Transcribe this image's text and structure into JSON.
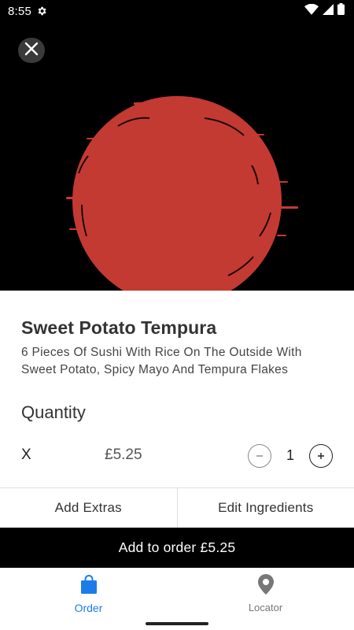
{
  "status_bar": {
    "time": "8:55"
  },
  "product": {
    "title": "Sweet Potato Tempura",
    "description": "6 Pieces Of Sushi With Rice On The Outside With Sweet Potato, Spicy Mayo And Tempura Flakes"
  },
  "quantity": {
    "heading": "Quantity",
    "prefix": "X",
    "unit_price": "£5.25",
    "minus_symbol": "−",
    "value": "1",
    "plus_symbol": "+"
  },
  "options": {
    "extras_label": "Add Extras",
    "ingredients_label": "Edit Ingredients"
  },
  "cta": {
    "label": "Add to order",
    "price": "£5.25"
  },
  "nav": {
    "items": [
      {
        "label": "Order",
        "icon": "shopping-bag-icon",
        "active": true
      },
      {
        "label": "Locator",
        "icon": "location-pin-icon",
        "active": false
      }
    ]
  },
  "colors": {
    "brand_red": "#c33a32",
    "accent_blue": "#1e7bea",
    "cta_black": "#000000"
  }
}
